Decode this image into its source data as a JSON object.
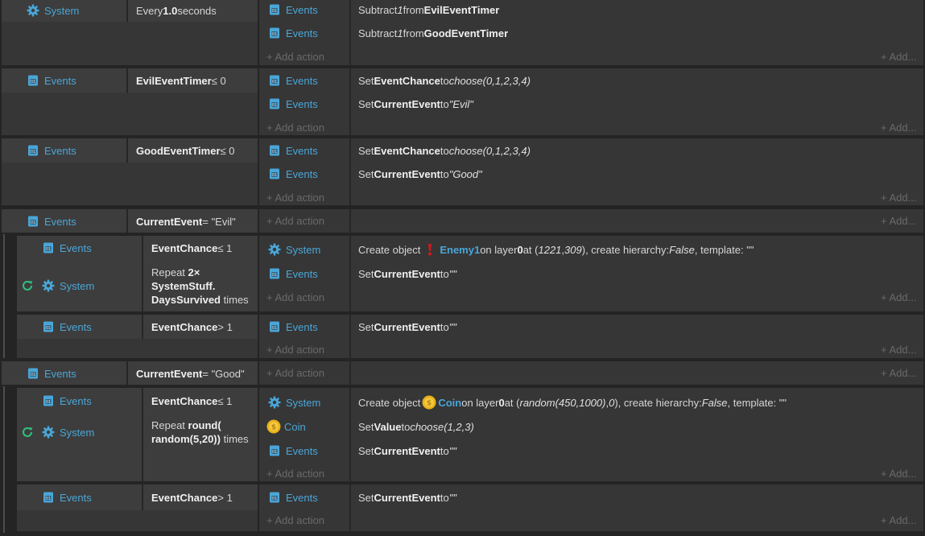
{
  "labels": {
    "system": "System",
    "events": "Events",
    "coin": "Coin",
    "add_action": "+ Add action",
    "add_more": "+ Add..."
  },
  "ev1": {
    "cond_prefix": "Every ",
    "cond_value": "1.0",
    "cond_suffix": " seconds",
    "a1": {
      "pre": "Subtract ",
      "num": "1",
      "mid": " from ",
      "var": "EvilEventTimer"
    },
    "a2": {
      "pre": "Subtract ",
      "num": "1",
      "mid": " from ",
      "var": "GoodEventTimer"
    }
  },
  "ev2": {
    "cond_var": "EvilEventTimer",
    "cond_rest": " ≤ 0",
    "a1": {
      "pre": "Set ",
      "var": "EventChance",
      "mid": " to ",
      "expr": "choose(0,1,2,3,4)"
    },
    "a2": {
      "pre": "Set ",
      "var": "CurrentEvent",
      "mid": " to ",
      "expr": "\"Evil\""
    }
  },
  "ev3": {
    "cond_var": "GoodEventTimer",
    "cond_rest": " ≤ 0",
    "a1": {
      "pre": "Set ",
      "var": "EventChance",
      "mid": " to ",
      "expr": "choose(0,1,2,3,4)"
    },
    "a2": {
      "pre": "Set ",
      "var": "CurrentEvent",
      "mid": " to ",
      "expr": "\"Good\""
    }
  },
  "ev4": {
    "cond_var": "CurrentEvent",
    "cond_rest": " = \"Evil\""
  },
  "ev5": {
    "cond1_var": "EventChance",
    "cond1_rest": " ≤ 1",
    "repeat_pre": "Repeat ",
    "repeat_l1": "2×",
    "repeat_l2": "SystemStuff.",
    "repeat_l3": "DaysSurvived",
    "repeat_suffix": " times",
    "a1": {
      "pre": "Create object ",
      "obj": "Enemy1",
      "m1": " on layer ",
      "layer": "0",
      "m2": " at (",
      "x": "1221",
      "c": ", ",
      "y": "309",
      "m3": "), create hierarchy: ",
      "h": "False",
      "m4": ", template: \"\""
    },
    "a2": {
      "pre": "Set ",
      "var": "CurrentEvent",
      "mid": " to ",
      "expr": "\"\""
    }
  },
  "ev6": {
    "cond_var": "EventChance",
    "cond_rest": " > 1",
    "a1": {
      "pre": "Set ",
      "var": "CurrentEvent",
      "mid": " to ",
      "expr": "\"\""
    }
  },
  "ev7": {
    "cond_var": "CurrentEvent",
    "cond_rest": " = \"Good\""
  },
  "ev8": {
    "cond1_var": "EventChance",
    "cond1_rest": " ≤ 1",
    "repeat_pre": "Repeat ",
    "repeat_l1": "round(",
    "repeat_l2": "random(5,20))",
    "repeat_suffix": " times",
    "a1": {
      "pre": "Create object ",
      "obj": "Coin",
      "m1": " on layer ",
      "layer": "0",
      "m2": " at (",
      "x": "random(450,1000)",
      "c": ", ",
      "y": "0",
      "m3": "), create hierarchy: ",
      "h": "False",
      "m4": ", template: \"\""
    },
    "a2": {
      "pre": "Set ",
      "var": "Value",
      "mid": " to ",
      "expr": "choose(1,2,3)"
    },
    "a3": {
      "pre": "Set ",
      "var": "CurrentEvent",
      "mid": " to ",
      "expr": "\"\""
    }
  },
  "ev9": {
    "cond_var": "EventChance",
    "cond_rest": " > 1",
    "a1": {
      "pre": "Set ",
      "var": "CurrentEvent",
      "mid": " to ",
      "expr": "\"\""
    }
  },
  "colors": {
    "link": "#4aa6d8",
    "repeat_icon": "#2ec27e",
    "coin": "#e8b21a",
    "enemy": "#d11a1a"
  }
}
